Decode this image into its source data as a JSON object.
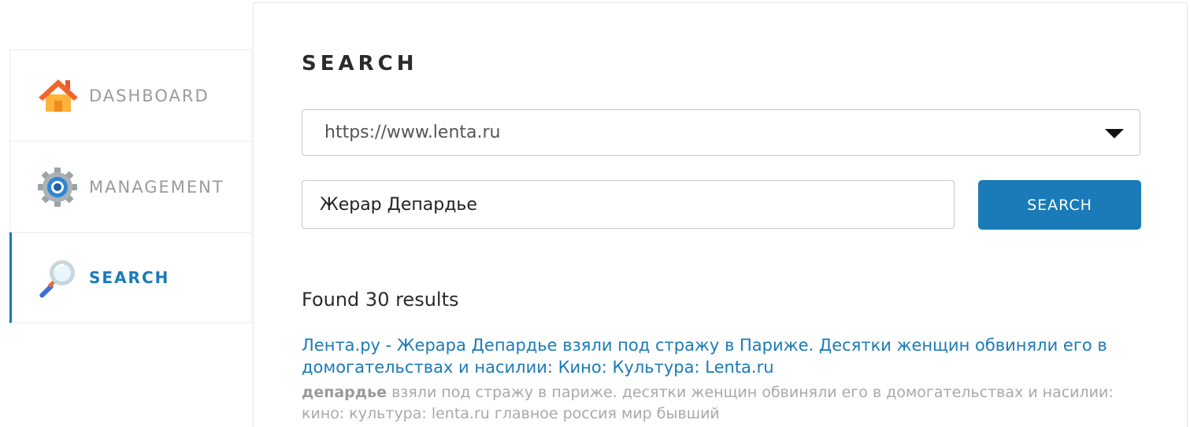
{
  "sidebar": {
    "items": [
      {
        "label": "DASHBOARD",
        "icon": "home-icon",
        "active": false
      },
      {
        "label": "MANAGEMENT",
        "icon": "gear-icon",
        "active": false
      },
      {
        "label": "SEARCH",
        "icon": "magnifier-icon",
        "active": true
      }
    ]
  },
  "main": {
    "title": "SEARCH",
    "source_select": {
      "value": "https://www.lenta.ru"
    },
    "query": {
      "value": "Жерар Депардье"
    },
    "search_button": "SEARCH",
    "results_count": "Found 30 results",
    "results": [
      {
        "title": "Лента.ру - Жерара Депардье взяли под стражу в Париже. Десятки женщин обвиняли его в домогательствах и насилии: Кино: Культура: Lenta.ru",
        "snippet_highlight": "депардье",
        "snippet_rest": " взяли под стражу в париже. десятки женщин обвиняли его в домогательствах и насилии: кино: культура: lenta.ru главное россия мир бывший"
      }
    ]
  },
  "colors": {
    "accent": "#1a7bb8",
    "muted_text": "#9b9b9b",
    "snippet_text": "#a9a9a9"
  }
}
